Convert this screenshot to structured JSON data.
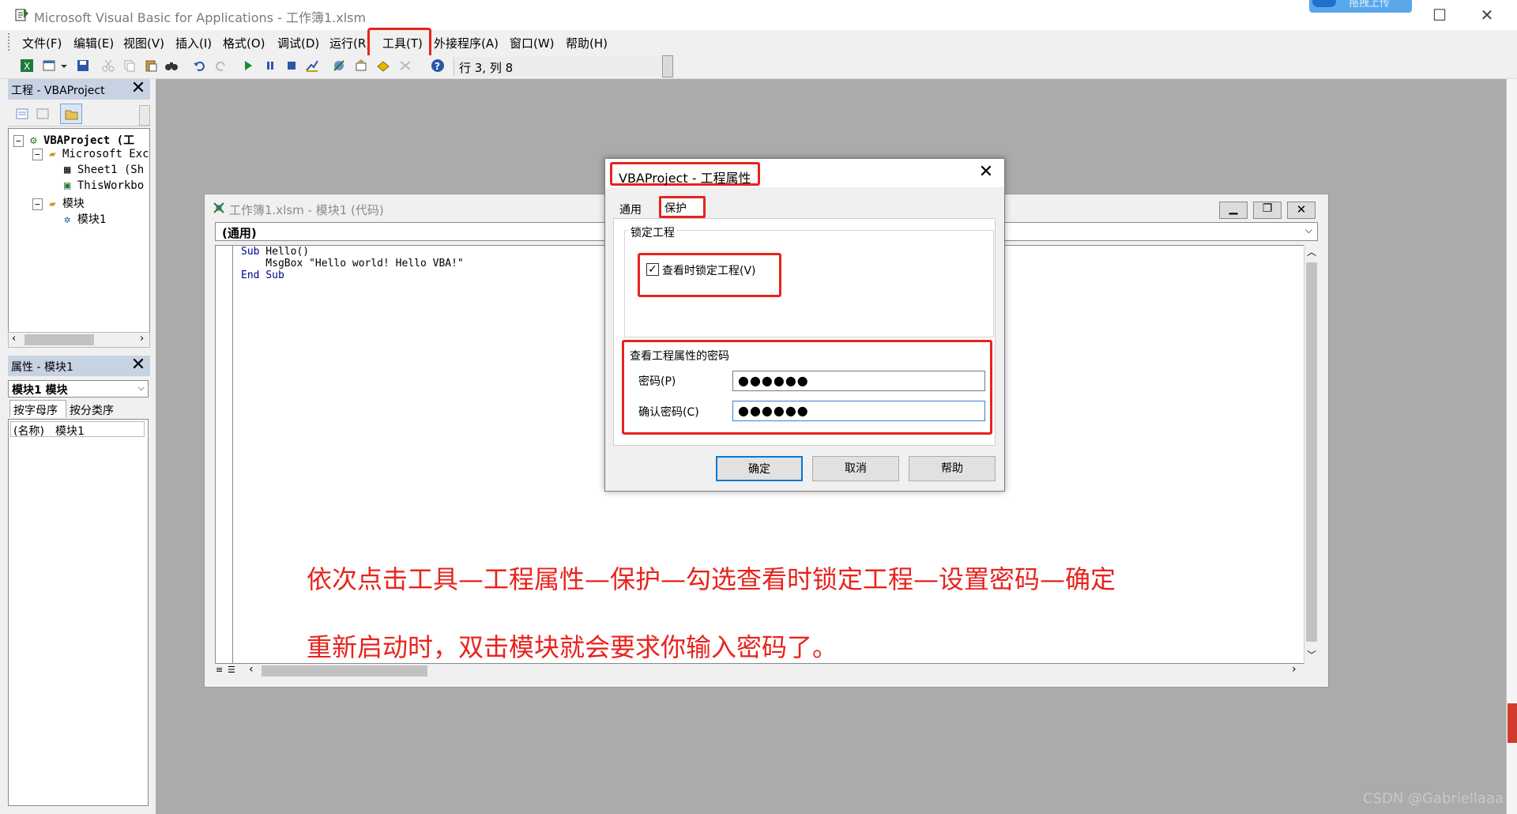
{
  "window": {
    "title": "Microsoft Visual Basic for Applications - 工作簿1.xlsm",
    "upload_badge": "拖拽上传",
    "icon": "vba-app-icon"
  },
  "menu": {
    "items": [
      {
        "label": "文件(F)"
      },
      {
        "label": "编辑(E)"
      },
      {
        "label": "视图(V)"
      },
      {
        "label": "插入(I)"
      },
      {
        "label": "格式(O)"
      },
      {
        "label": "调试(D)"
      },
      {
        "label": "运行(R)"
      },
      {
        "label": "工具(T)"
      },
      {
        "label": "外接程序(A)"
      },
      {
        "label": "窗口(W)"
      },
      {
        "label": "帮助(H)"
      }
    ]
  },
  "toolbar": {
    "status": "行 3, 列 8"
  },
  "project_pane": {
    "title": "工程 - VBAProject",
    "tree": [
      {
        "label": "VBAProject (工"
      },
      {
        "label": "Microsoft Exc"
      },
      {
        "label": "Sheet1 (Sh"
      },
      {
        "label": "ThisWorkbo"
      },
      {
        "label": "模块"
      },
      {
        "label": "模块1"
      }
    ]
  },
  "properties_pane": {
    "title": "属性 - 模块1",
    "object_combo": "模块1 模块",
    "tab_alpha": "按字母序",
    "tab_category": "按分类序",
    "row_name": "(名称)",
    "row_value": "模块1"
  },
  "code_window": {
    "title": "工作簿1.xlsm - 模块1 (代码)",
    "object_combo": "(通用)",
    "code_lines": [
      {
        "kw": "Sub",
        "rest": " Hello()"
      },
      {
        "kw": "",
        "rest": "    MsgBox \"Hello world! Hello VBA!\""
      },
      {
        "kw": "End Sub",
        "rest": ""
      }
    ]
  },
  "annotation": {
    "line1": "依次点击工具—工程属性—保护—勾选查看时锁定工程—设置密码—确定",
    "line2": "重新启动时，双击模块就会要求你输入密码了。"
  },
  "dialog": {
    "title": "VBAProject - 工程属性",
    "tab_general": "通用",
    "tab_protection": "保护",
    "lock_group": "锁定工程",
    "lock_checkbox": "查看时锁定工程(V)",
    "lock_checked": true,
    "password_group": "查看工程属性的密码",
    "password_label": "密码(P)",
    "password_value": "●●●●●●",
    "confirm_label": "确认密码(C)",
    "confirm_value": "●●●●●●",
    "ok": "确定",
    "cancel": "取消",
    "help": "帮助"
  },
  "watermark": "CSDN @Gabriellaaa",
  "colors": {
    "highlight": "#e8231d",
    "workspace": "#ababab",
    "pane_title": "#c7d3e3"
  }
}
